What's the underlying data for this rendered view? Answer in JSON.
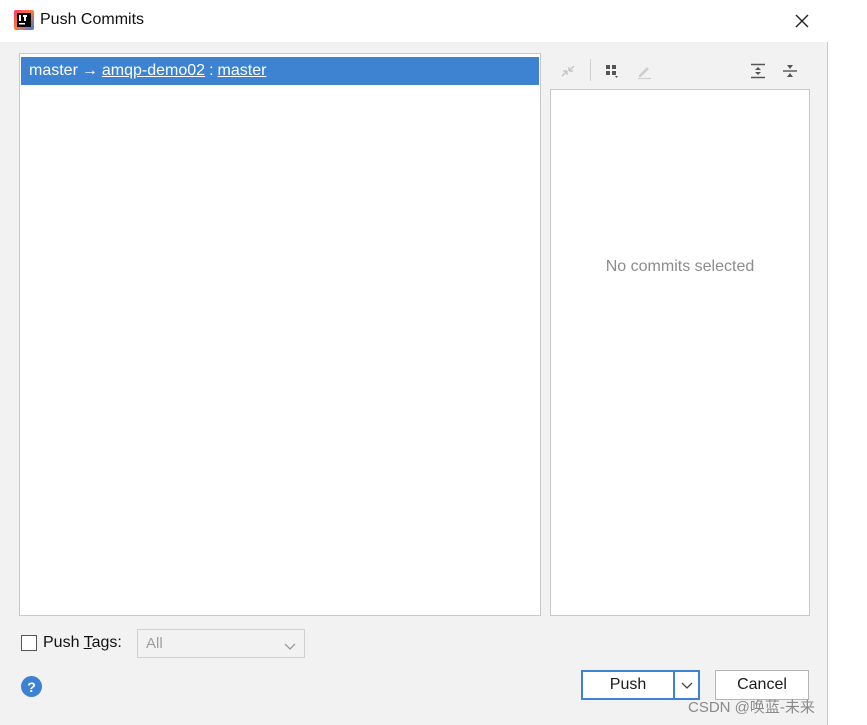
{
  "window": {
    "title": "Push Commits"
  },
  "branch": {
    "local": "master",
    "arrow": "→",
    "remote": "amqp-demo02",
    "separator": ":",
    "remote_branch": "master"
  },
  "details": {
    "empty_text": "No commits selected"
  },
  "tags": {
    "label_prefix": "Push ",
    "label_underlined": "T",
    "label_suffix": "ags:",
    "checked": false,
    "selected": "All"
  },
  "buttons": {
    "push": "Push",
    "cancel": "Cancel",
    "help": "?"
  },
  "watermark": "CSDN @唤蓝-未来",
  "colors": {
    "selection": "#3d83d1",
    "accent": "#3b82d6"
  }
}
